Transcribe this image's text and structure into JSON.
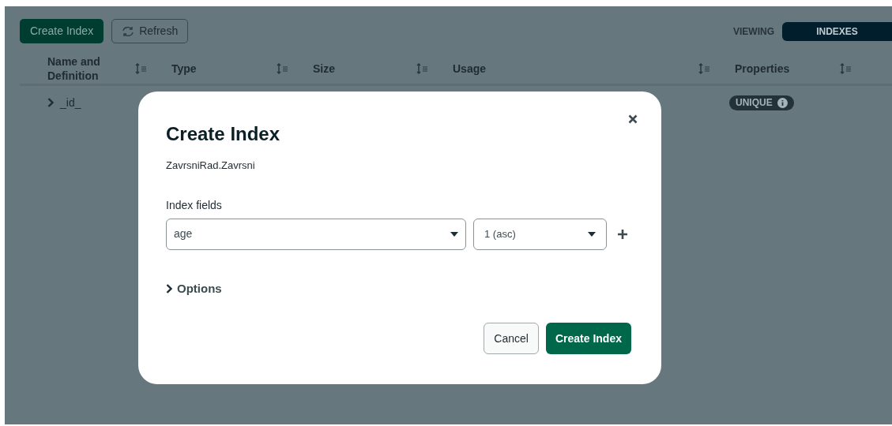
{
  "toolbar": {
    "create_button": "Create Index",
    "refresh_button": "Refresh"
  },
  "view_toggle": [
    {
      "label": "VIEWING",
      "selected": false
    },
    {
      "label": "INDEXES",
      "selected": true
    }
  ],
  "table": {
    "columns": [
      "Name and Definition",
      "Type",
      "Size",
      "Usage",
      "Properties"
    ],
    "rows": [
      {
        "name": "_id_",
        "expanded": false,
        "property_badge": "UNIQUE"
      }
    ]
  },
  "modal": {
    "title": "Create Index",
    "namespace": "ZavrsniRad.Zavrsni",
    "fields_label": "Index fields",
    "field": {
      "value": "age"
    },
    "direction": {
      "value": "1 (asc)"
    },
    "options": {
      "label": "Options",
      "expanded": false
    },
    "buttons": {
      "cancel": "Cancel",
      "submit": "Create Index"
    }
  }
}
